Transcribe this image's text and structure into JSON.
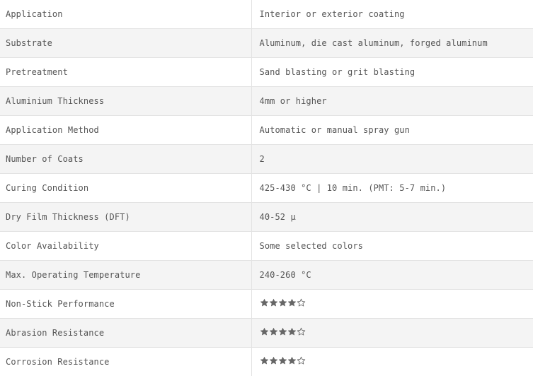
{
  "rows": [
    {
      "label": "Application",
      "value": "Interior or exterior coating"
    },
    {
      "label": "Substrate",
      "value": "Aluminum, die cast aluminum, forged aluminum"
    },
    {
      "label": "Pretreatment",
      "value": "Sand blasting or grit blasting"
    },
    {
      "label": "Aluminium Thickness",
      "value": "4mm or higher"
    },
    {
      "label": "Application Method",
      "value": "Automatic or manual spray gun"
    },
    {
      "label": "Number of Coats",
      "value": "2"
    },
    {
      "label": "Curing Condition",
      "value": "425-430 °C | 10 min. (PMT: 5-7 min.)"
    },
    {
      "label": "Dry Film Thickness (DFT)",
      "value": "40-52 µ"
    },
    {
      "label": "Color Availability",
      "value": "Some selected colors"
    },
    {
      "label": "Max. Operating Temperature",
      "value": "240-260 °C"
    }
  ],
  "rating_rows": [
    {
      "label": "Non-Stick Performance",
      "rating": 4,
      "max": 5
    },
    {
      "label": "Abrasion Resistance",
      "rating": 4,
      "max": 5
    },
    {
      "label": "Corrosion Resistance",
      "rating": 4,
      "max": 5
    }
  ],
  "colors": {
    "star_filled": "#666666",
    "star_empty": "#666666"
  },
  "icons": {
    "filled": "star-filled-icon",
    "empty": "star-outline-icon"
  }
}
